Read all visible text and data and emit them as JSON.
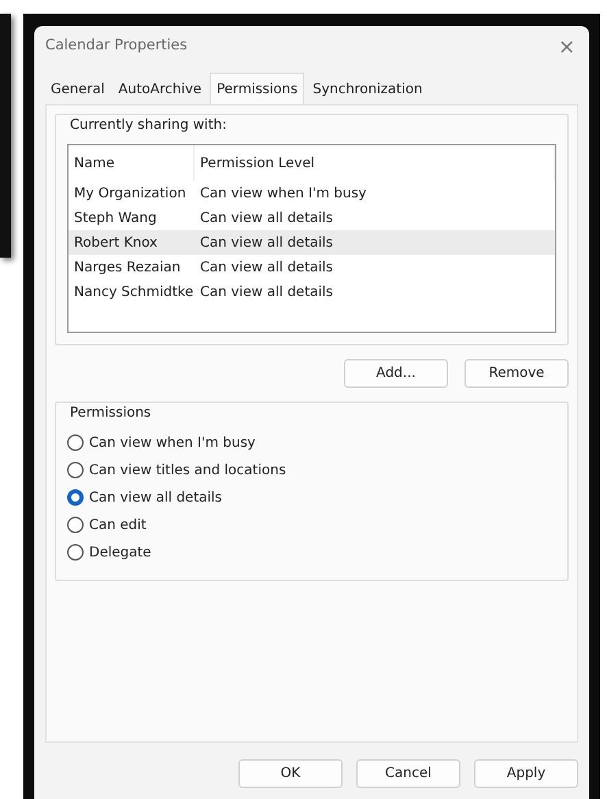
{
  "window": {
    "title": "Calendar Properties",
    "close": "×"
  },
  "tabs": [
    {
      "label": "General",
      "selected": false
    },
    {
      "label": "AutoArchive",
      "selected": false
    },
    {
      "label": "Permissions",
      "selected": true
    },
    {
      "label": "Synchronization",
      "selected": false
    }
  ],
  "sharing": {
    "title": "Currently sharing with:",
    "columns": [
      "Name",
      "Permission Level"
    ],
    "rows": [
      {
        "name": "My Organization",
        "level": "Can view when I'm busy",
        "selected": false
      },
      {
        "name": "Steph Wang",
        "level": "Can view all details",
        "selected": false
      },
      {
        "name": "Robert Knox",
        "level": "Can view all details",
        "selected": true
      },
      {
        "name": "Narges Rezaian",
        "level": "Can view all details",
        "selected": false
      },
      {
        "name": "Nancy Schmidtke",
        "level": "Can view all details",
        "selected": false
      }
    ],
    "buttons": [
      "Add...",
      "Remove"
    ]
  },
  "permissions": {
    "title": "Permissions",
    "options": [
      {
        "label": "Can view when I'm busy",
        "selected": false
      },
      {
        "label": "Can view titles and locations",
        "selected": false
      },
      {
        "label": "Can view all details",
        "selected": true
      },
      {
        "label": "Can edit",
        "selected": false
      },
      {
        "label": "Delegate",
        "selected": false
      }
    ]
  },
  "buttons": [
    "OK",
    "Cancel",
    "Apply"
  ]
}
